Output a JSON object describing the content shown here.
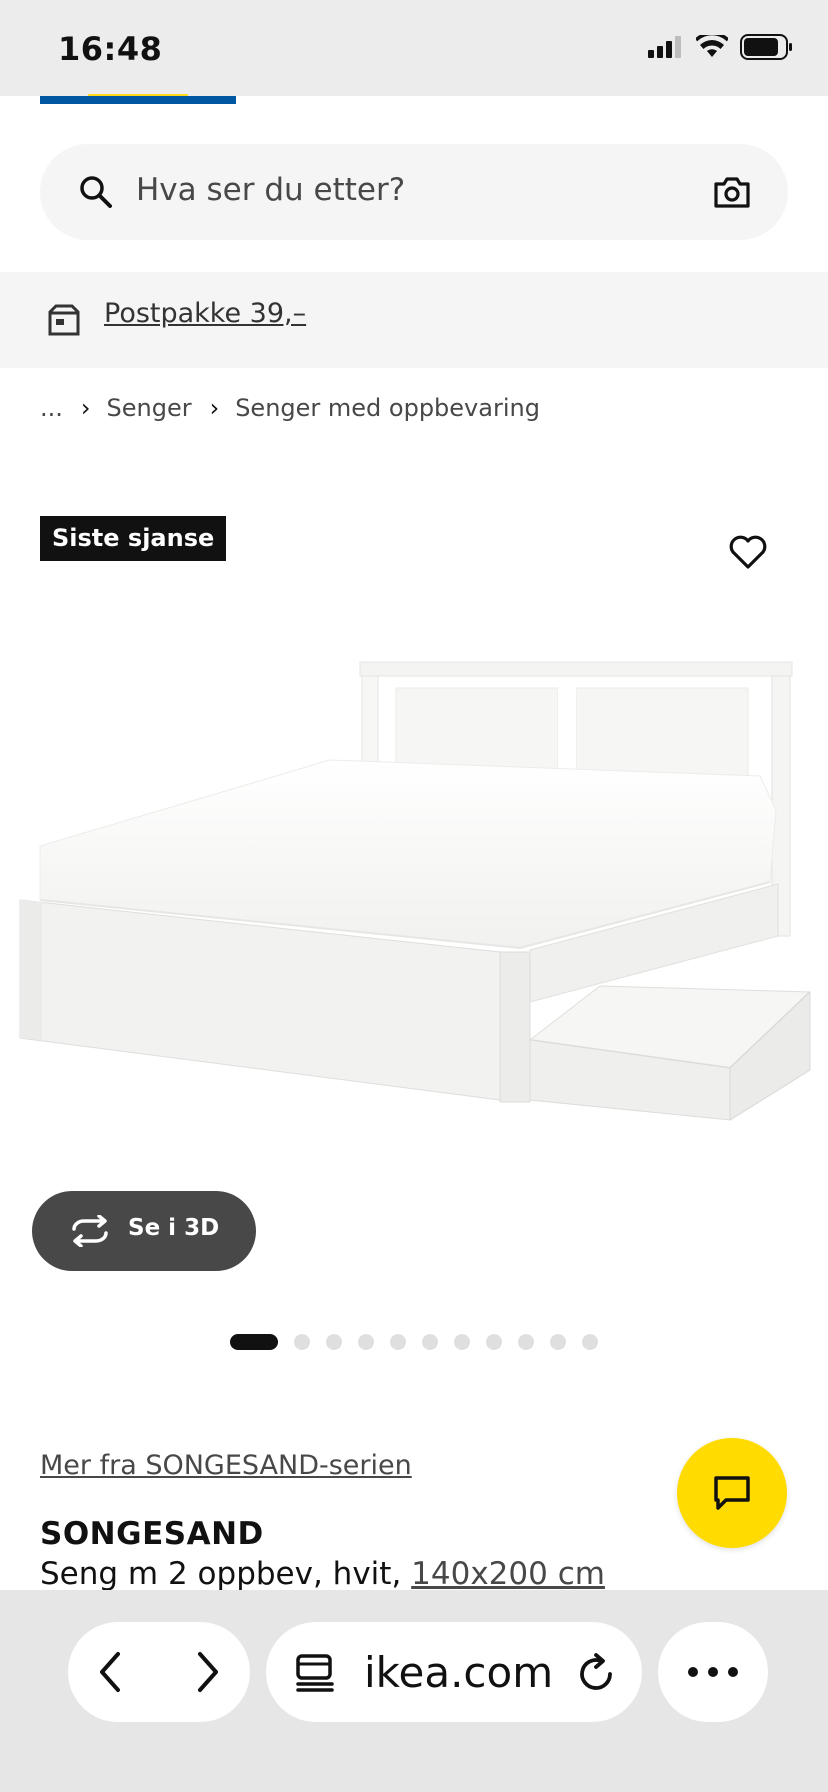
{
  "status_bar": {
    "time": "16:48",
    "icons": [
      "signal-icon",
      "wifi-icon",
      "battery-icon"
    ]
  },
  "header": {
    "logo": "ikea-logo",
    "brand_colors": {
      "blue": "#0058a3",
      "yellow": "#ffda1a"
    }
  },
  "search": {
    "placeholder": "Hva ser du etter?",
    "icons": [
      "search-icon",
      "camera-icon"
    ]
  },
  "promo": {
    "icon": "parcel-icon",
    "text": "Postpakke 39,–"
  },
  "breadcrumb": {
    "items": [
      "...",
      "Senger",
      "Senger med oppbevaring"
    ]
  },
  "product": {
    "badge": "Siste sjanse",
    "favorite_icon": "heart-icon",
    "image": "white bed frame with two storage drawers",
    "view_3d_label": "Se i 3D",
    "carousel": {
      "count": 11,
      "active_index": 0
    },
    "series_link": "Mer fra SONGESAND-serien",
    "name": "SONGESAND",
    "description": "Seng m 2 oppbev, hvit, ",
    "size": "140x200 cm"
  },
  "chat": {
    "icon": "chat-icon",
    "color": "#ffdb00"
  },
  "browser": {
    "url": "ikea.com",
    "icons": [
      "back-icon",
      "forward-icon",
      "tabs-icon",
      "reload-icon",
      "more-icon"
    ]
  }
}
